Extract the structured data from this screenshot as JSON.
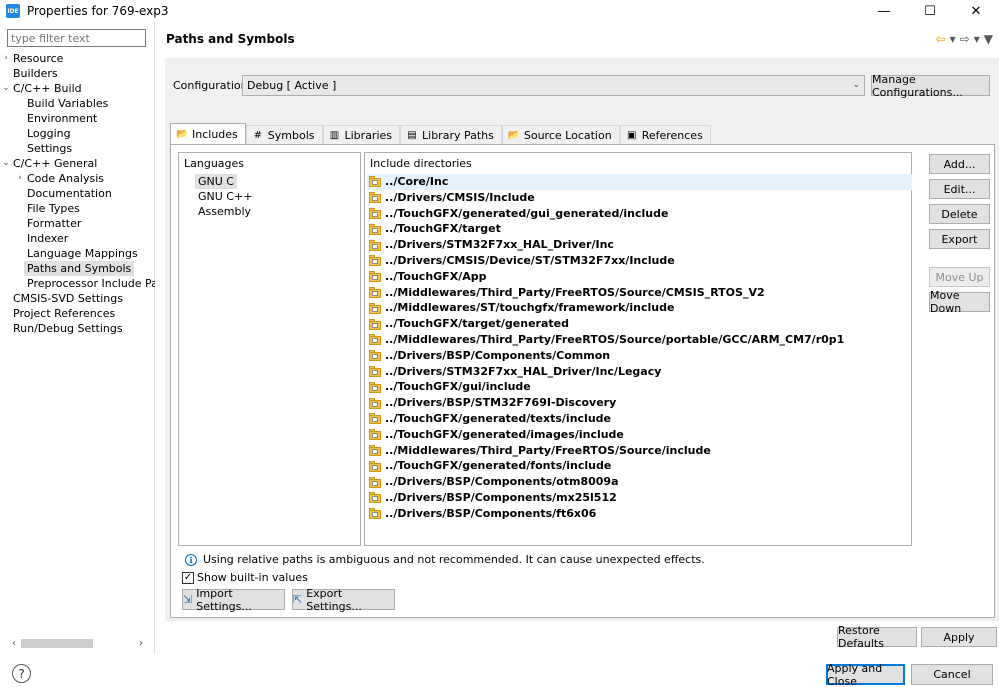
{
  "window": {
    "icon_text": "IDE",
    "title": "Properties for 769-exp3"
  },
  "left": {
    "filter_placeholder": "type filter text",
    "tree": [
      {
        "label": "Resource",
        "level": 0,
        "arrow": "›"
      },
      {
        "label": "Builders",
        "level": 0,
        "arrow": ""
      },
      {
        "label": "C/C++ Build",
        "level": 0,
        "arrow": "⌄"
      },
      {
        "label": "Build Variables",
        "level": 1,
        "arrow": ""
      },
      {
        "label": "Environment",
        "level": 1,
        "arrow": ""
      },
      {
        "label": "Logging",
        "level": 1,
        "arrow": ""
      },
      {
        "label": "Settings",
        "level": 1,
        "arrow": ""
      },
      {
        "label": "C/C++ General",
        "level": 0,
        "arrow": "⌄"
      },
      {
        "label": "Code Analysis",
        "level": 1,
        "arrow": "›"
      },
      {
        "label": "Documentation",
        "level": 1,
        "arrow": ""
      },
      {
        "label": "File Types",
        "level": 1,
        "arrow": ""
      },
      {
        "label": "Formatter",
        "level": 1,
        "arrow": ""
      },
      {
        "label": "Indexer",
        "level": 1,
        "arrow": ""
      },
      {
        "label": "Language Mappings",
        "level": 1,
        "arrow": ""
      },
      {
        "label": "Paths and Symbols",
        "level": 1,
        "arrow": "",
        "selected": true
      },
      {
        "label": "Preprocessor Include Pat",
        "level": 1,
        "arrow": ""
      },
      {
        "label": "CMSIS-SVD Settings",
        "level": 0,
        "arrow": ""
      },
      {
        "label": "Project References",
        "level": 0,
        "arrow": ""
      },
      {
        "label": "Run/Debug Settings",
        "level": 0,
        "arrow": ""
      }
    ]
  },
  "main": {
    "title": "Paths and Symbols",
    "config_label": "Configuration:",
    "config_value": "Debug  [ Active ]",
    "manage_button": "Manage Configurations...",
    "tabs": [
      {
        "label": "Includes",
        "icon": "📂",
        "active": true
      },
      {
        "label": "Symbols",
        "icon": "#"
      },
      {
        "label": "Libraries",
        "icon": "▥"
      },
      {
        "label": "Library Paths",
        "icon": "▤"
      },
      {
        "label": "Source Location",
        "icon": "📂"
      },
      {
        "label": "References",
        "icon": "▣"
      }
    ],
    "languages_header": "Languages",
    "languages": [
      "GNU C",
      "GNU C++",
      "Assembly"
    ],
    "include_header": "Include directories",
    "includes": [
      "../Core/Inc",
      "../Drivers/CMSIS/Include",
      "../TouchGFX/generated/gui_generated/include",
      "../TouchGFX/target",
      "../Drivers/STM32F7xx_HAL_Driver/Inc",
      "../Drivers/CMSIS/Device/ST/STM32F7xx/Include",
      "../TouchGFX/App",
      "../Middlewares/Third_Party/FreeRTOS/Source/CMSIS_RTOS_V2",
      "../Middlewares/ST/touchgfx/framework/include",
      "../TouchGFX/target/generated",
      "../Middlewares/Third_Party/FreeRTOS/Source/portable/GCC/ARM_CM7/r0p1",
      "../Drivers/BSP/Components/Common",
      "../Drivers/STM32F7xx_HAL_Driver/Inc/Legacy",
      "../TouchGFX/gui/include",
      "../Drivers/BSP/STM32F769I-Discovery",
      "../TouchGFX/generated/texts/include",
      "../TouchGFX/generated/images/include",
      "../Middlewares/Third_Party/FreeRTOS/Source/include",
      "../TouchGFX/generated/fonts/include",
      "../Drivers/BSP/Components/otm8009a",
      "../Drivers/BSP/Components/mx25l512",
      "../Drivers/BSP/Components/ft6x06"
    ],
    "side_buttons": {
      "add": "Add...",
      "edit": "Edit...",
      "delete": "Delete",
      "export": "Export",
      "move_up": "Move Up",
      "move_down": "Move Down"
    },
    "info_text": "Using relative paths is ambiguous and not recommended. It can cause unexpected effects.",
    "show_builtin_label": "Show built-in values",
    "show_builtin_checked": true,
    "import_button": "Import Settings...",
    "export_button": "Export Settings...",
    "restore_defaults": "Restore Defaults",
    "apply": "Apply"
  },
  "footer": {
    "apply_close": "Apply and Close",
    "cancel": "Cancel"
  }
}
